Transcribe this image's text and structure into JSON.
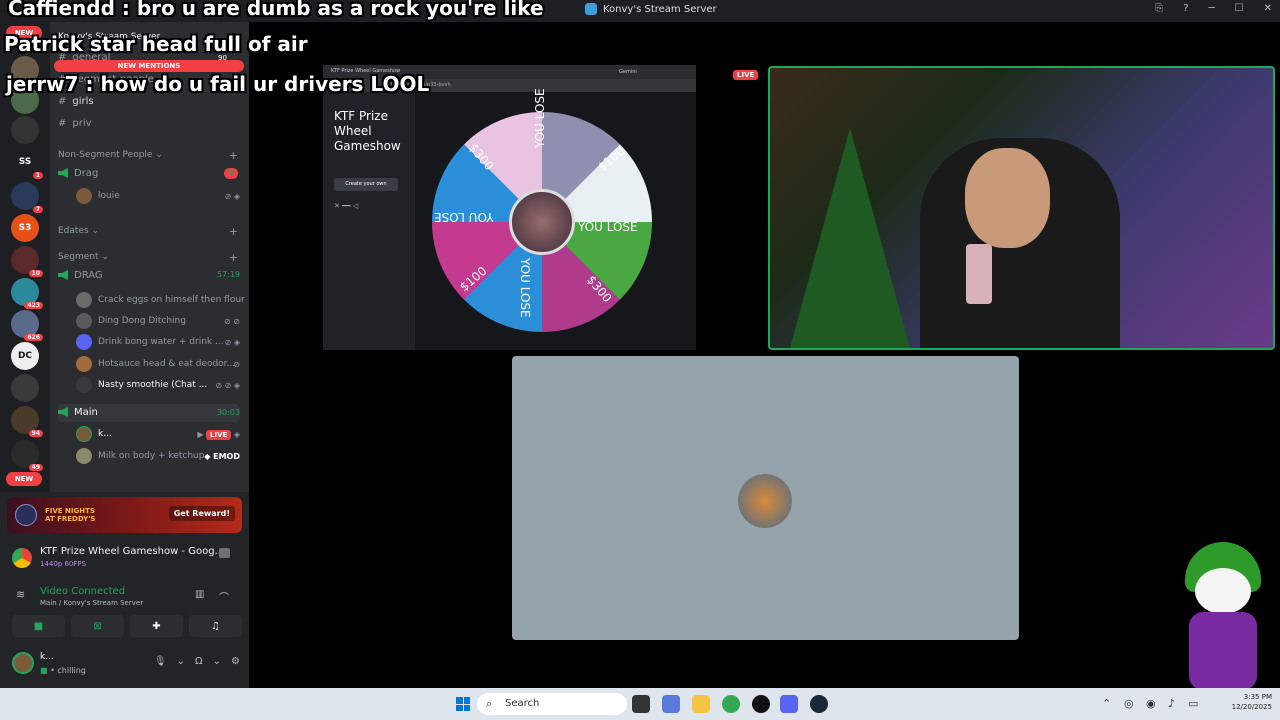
{
  "window": {
    "title": "Konvy's Stream Server",
    "help": "?",
    "minimize": "─",
    "maximize": "☐",
    "close": "✕",
    "inbox": "⎘"
  },
  "chat_overlay": [
    {
      "user": "Caffiendd",
      "text": ": bro u are dumb as a rock you're like"
    },
    {
      "user": "Patrick star head full of air",
      "text": ""
    },
    {
      "user": "jerrw7",
      "text": ": how do u fail ur drivers LOOL"
    }
  ],
  "server_bar": {
    "new_top": "NEW",
    "new_bottom": "NEW",
    "servers": [
      {
        "label": "",
        "badge": ""
      },
      {
        "label": "",
        "badge": ""
      },
      {
        "label": "",
        "badge": ""
      },
      {
        "label": "",
        "badge": ""
      },
      {
        "label": "SS",
        "badge": "1"
      },
      {
        "label": "",
        "badge": "7"
      },
      {
        "label": "S3",
        "badge": ""
      },
      {
        "label": "",
        "badge": "10"
      },
      {
        "label": "",
        "badge": "423"
      },
      {
        "label": "",
        "badge": "626"
      },
      {
        "label": "DC",
        "badge": ""
      },
      {
        "label": "",
        "badge": ""
      },
      {
        "label": "",
        "badge": "94"
      },
      {
        "label": "",
        "badge": "49"
      }
    ]
  },
  "sidebar": {
    "server_name": "Konvy's Stream Server",
    "new_mentions": "NEW MENTIONS",
    "general": "general",
    "general_count": "90",
    "segment_people": "segment-people",
    "girls": "girls",
    "priv": "priv",
    "cat_nonseg": "Non-Segment People",
    "drag": "Drag",
    "drag_badge": "2",
    "louie": "louie",
    "cat_edates": "Edates",
    "cat_segment": "Segment",
    "drag_vc": "DRAG",
    "drag_time": "57:19",
    "drag_users": [
      "Crack eggs on himself then flour",
      "Ding Dong Ditching",
      "Drink bong water + drink ...",
      "Hotsauce head & eat deodor...",
      "Nasty smoothie (Chat ..."
    ],
    "main_vc": "Main",
    "main_time": "30:03",
    "main_user1": "k...",
    "live": "LIVE",
    "main_user2": "Milk on body + ketchup",
    "emod": "EMOD"
  },
  "panel": {
    "promo_game": "FIVE NIGHTS AT FREDDY'S",
    "promo_button": "Get Reward!",
    "stream_title": "KTF Prize Wheel Gameshow - Goog...",
    "stream_quality": "1440p 60FPS",
    "voice_status": "Video Connected",
    "voice_sub": "Main / Konvy's Stream Server",
    "me_name": "k...",
    "me_status": "chilling"
  },
  "browser": {
    "tab": "KTF Prize Wheel Gameshow",
    "gemini": "Gemini",
    "url": "pollsmamos.com/p33-bvvh",
    "heading": "KTF Prize Wheel Gameshow",
    "create_btn": "Create your own",
    "wheel": [
      "YOU LOSE",
      "$100",
      "YOU LOSE",
      "$300",
      "YOU LOSE",
      "$100",
      "YOU LOSE",
      "$300"
    ]
  },
  "stream_live_badge": "LIVE",
  "taskbar": {
    "search": "Search",
    "time": "3:35 PM",
    "date": "12/20/2025"
  },
  "colors": {
    "accent_green": "#23a55a",
    "danger": "#f23f43",
    "sidebar": "#2b2d31"
  }
}
